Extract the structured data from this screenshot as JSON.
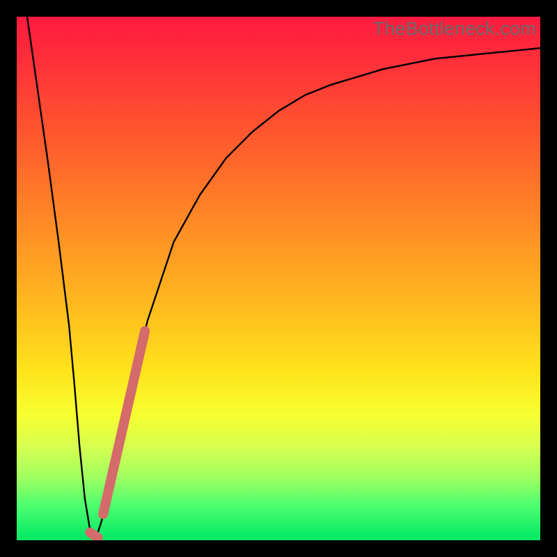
{
  "watermark": "TheBottleneck.com",
  "chart_data": {
    "type": "line",
    "title": "",
    "xlabel": "",
    "ylabel": "",
    "xlim": [
      0,
      100
    ],
    "ylim": [
      0,
      100
    ],
    "grid": false,
    "series": [
      {
        "name": "bottleneck-percent",
        "stroke": "#000000",
        "stroke_width": 2.4,
        "x": [
          2,
          4,
          6,
          8,
          10,
          11,
          12,
          13,
          14,
          15,
          16,
          18,
          20,
          22,
          25,
          30,
          35,
          40,
          45,
          50,
          55,
          60,
          70,
          80,
          90,
          100
        ],
        "y": [
          100,
          86,
          72,
          57,
          41,
          30,
          18,
          8,
          2,
          0,
          3,
          10,
          20,
          30,
          42,
          57,
          66,
          73,
          78,
          82,
          85,
          87,
          90,
          92,
          93,
          94
        ]
      }
    ],
    "highlight": {
      "name": "selected-range",
      "stroke": "#d46a6a",
      "stroke_width": 14,
      "linecap": "round",
      "segments": [
        {
          "x": [
            14.0,
            15.5
          ],
          "y": [
            1.5,
            0.5
          ]
        },
        {
          "x": [
            16.5,
            24.5
          ],
          "y": [
            5,
            40
          ]
        }
      ]
    }
  }
}
